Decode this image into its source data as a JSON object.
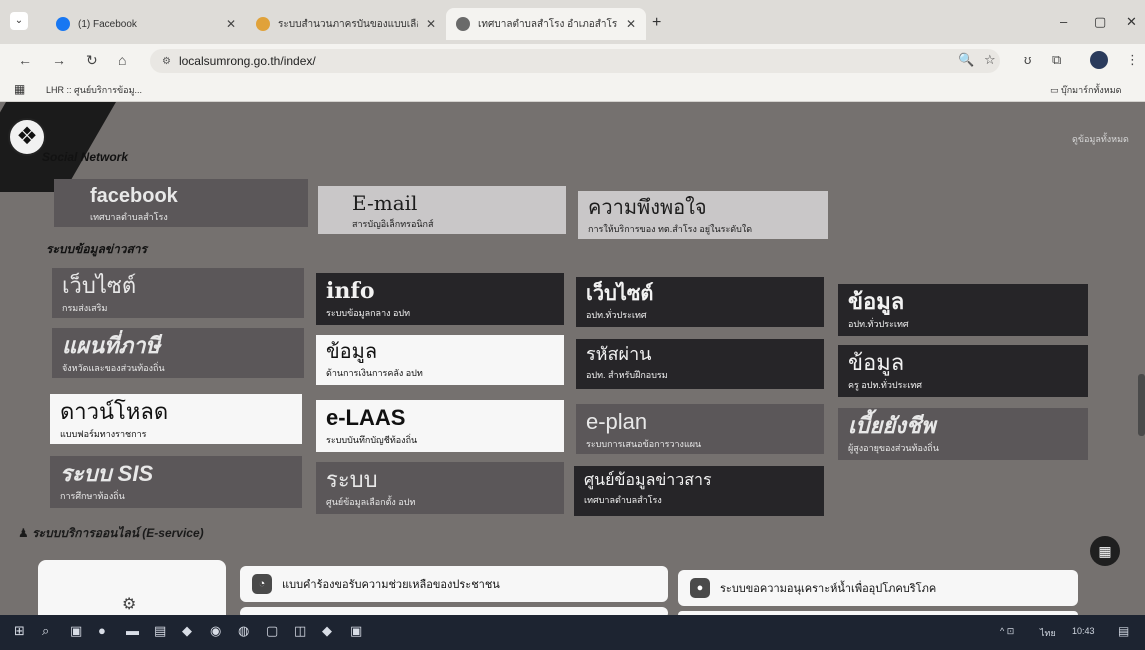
{
  "browser": {
    "tabs": [
      {
        "title": "(1) Facebook",
        "favicon_color": "#1877f2"
      },
      {
        "title": "ระบบสำนวนภาครบันของแบบเลือง",
        "favicon_color": "#e0a23a"
      },
      {
        "title": "เทศบาลตำบลสำโรง อำเภอสำโรง จัง",
        "favicon_color": "#6a6a6a"
      }
    ],
    "tab_menu_icon": "chevron-down",
    "new_tab": "+",
    "window_controls": {
      "minimize": "–",
      "maximize": "▢",
      "close": "✕"
    },
    "nav": {
      "back": "←",
      "forward": "→",
      "reload": "↻",
      "home": "⌂"
    },
    "url": "localsumrong.go.th/index/",
    "url_tune": "⚙",
    "right_icons": {
      "zoom": "🔍",
      "star": "☆",
      "ext": "ʊ",
      "puzzle": "⧉"
    },
    "bookmarks": {
      "apps": "▦",
      "item": "LHR :: ศูนย์บริการข้อมู...",
      "folder": "บุ๊กมาร์กทั้งหมด"
    }
  },
  "page": {
    "section_social": "Social Network",
    "corner_link": "ดูข้อมูลทั้งหมด",
    "social": [
      {
        "title": "facebook",
        "sub": "เทศบาลตำบลสำโรง",
        "style": "c-mid"
      },
      {
        "title": "E-mail",
        "sub": "สารบัญอิเล็กทรอนิกส์",
        "style": "c-lgrey"
      },
      {
        "title": "ความพึงพอใจ",
        "sub": "การให้บริการของ ทต.สำโรง อยู่ในระดับใด",
        "style": "c-lgrey"
      }
    ],
    "section_info": "ระบบข้อมูลข่าวสาร",
    "info": [
      {
        "title": "เว็บไซต์",
        "sub": "กรมส่งเสริม",
        "style": "c-mid"
      },
      {
        "title": "info",
        "sub": "ระบบข้อมูลกลาง อปท",
        "style": "c-dark"
      },
      {
        "title": "เว็บไซต์",
        "sub": "อปท.ทั่วประเทศ",
        "style": "c-dark"
      },
      {
        "title": "ข้อมูล",
        "sub": "อปท.ทั่วประเทศ",
        "style": "c-dark"
      },
      {
        "title": "แผนที่ภาษี",
        "sub": "จังหวัดและของส่วนท้องถิ่น",
        "style": "c-mid"
      },
      {
        "title": "ข้อมูล",
        "sub": "ด้านการเงินการคลัง อปท",
        "style": "c-white"
      },
      {
        "title": "รหัสผ่าน",
        "sub": "อปท. สำหรับฝึกอบรม",
        "style": "c-dark"
      },
      {
        "title": "ข้อมูล",
        "sub": "ครู อปท.ทั่วประเทศ",
        "style": "c-dark"
      },
      {
        "title": "ดาวน์โหลด",
        "sub": "แบบฟอร์มทางราชการ",
        "style": "c-white"
      },
      {
        "title": "e-LAAS",
        "sub": "ระบบบันทึกบัญชีท้องถิ่น",
        "style": "c-white"
      },
      {
        "title": "e-plan",
        "sub": "ระบบการเสนอข้อการวางแผน",
        "style": "c-mid"
      },
      {
        "title": "เบี้ยยังชีพ",
        "sub": "ผู้สูงอายุของส่วนท้องถิ่น",
        "style": "c-mid"
      },
      {
        "title": "ระบบ SIS",
        "sub": "การศึกษาท้องถิ่น",
        "style": "c-mid"
      },
      {
        "title": "ระบบ",
        "sub": "ศูนย์ข้อมูลเลือกตั้ง อปท",
        "style": "c-mid"
      },
      {
        "title": "ศูนย์ข้อมูลข่าวสาร",
        "sub": "เทศบาลตำบลสำโรง",
        "style": "c-dark"
      }
    ],
    "section_eservice": "ระบบบริการออนไลน์ (E-service)",
    "services": [
      {
        "label": "แบบคำร้องขอรับความช่วยเหลือของประชาชน",
        "icon": "◔"
      },
      {
        "label": "ระบบขอความอนุเคราะห์น้ำเพื่ออุปโภคบริโภค",
        "icon": "●"
      }
    ],
    "fab_icon": "▦",
    "panel_icon": "⚙"
  },
  "taskbar": {
    "start": "⊞",
    "search": "⌕",
    "apps": [
      "▣",
      "●",
      "▬",
      "▤",
      "◆",
      "◉",
      "◍",
      "▢",
      "◫",
      "◆",
      "▣"
    ],
    "tray": {
      "icons": "^ ⊡",
      "lang": "ไทย",
      "time": "10:43",
      "notify": "▤"
    }
  }
}
